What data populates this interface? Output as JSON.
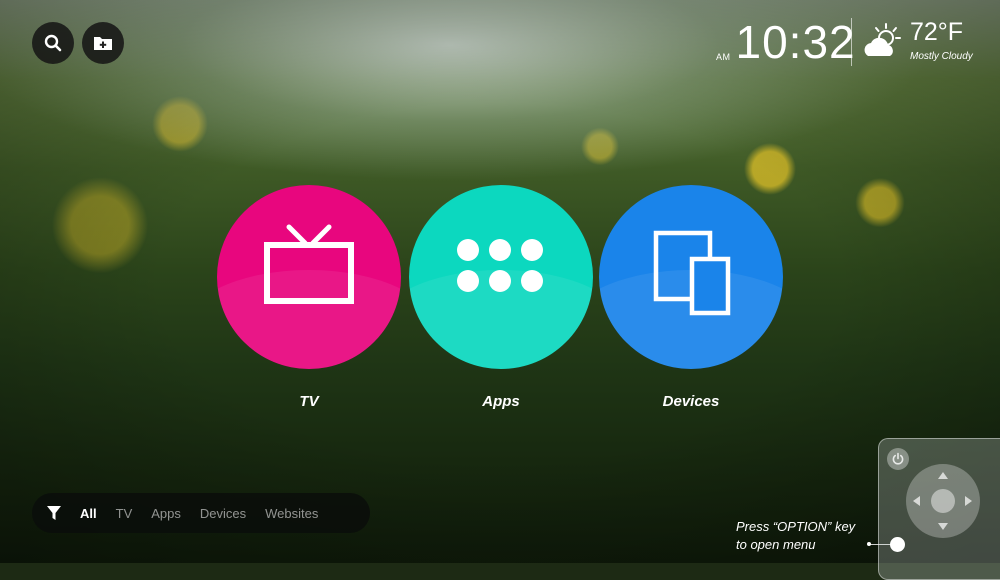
{
  "top_buttons": [
    {
      "icon": "search-icon"
    },
    {
      "icon": "add-folder-icon"
    }
  ],
  "clock": {
    "ampm": "AM",
    "time": "10:32"
  },
  "weather": {
    "icon": "partly-cloudy-icon",
    "temp": "72°F",
    "description": "Mostly Cloudy"
  },
  "tiles": [
    {
      "label": "TV",
      "icon": "tv-icon",
      "color": "#e8067e"
    },
    {
      "label": "Apps",
      "icon": "apps-grid-icon",
      "color": "#0cd8bf"
    },
    {
      "label": "Devices",
      "icon": "devices-icon",
      "color": "#1a84ea"
    }
  ],
  "filter_bar": {
    "icon": "filter-icon",
    "items": [
      "All",
      "TV",
      "Apps",
      "Devices",
      "Websites"
    ],
    "active": "All"
  },
  "hint": {
    "line1": "Press “OPTION” key",
    "line2": "to open menu"
  },
  "remote": {
    "power_icon": "power-icon",
    "dpad_icon": "dpad-icon"
  }
}
